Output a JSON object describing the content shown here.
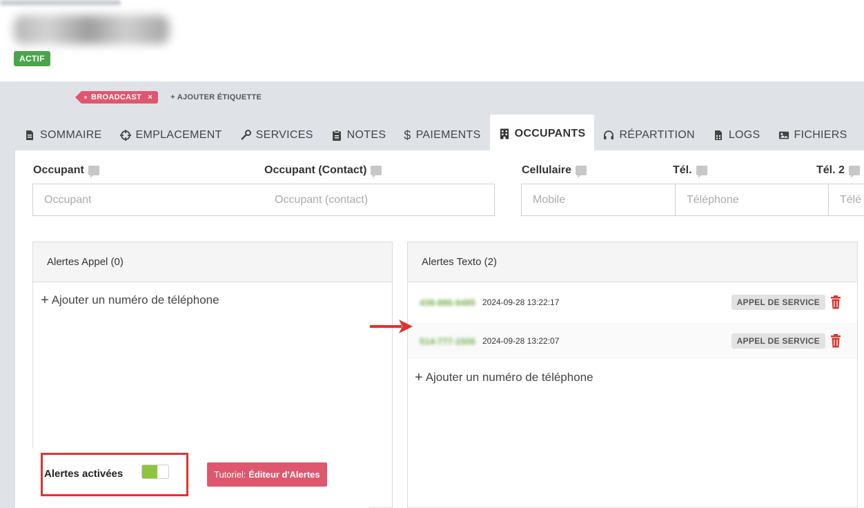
{
  "header": {
    "status": "ACTIF"
  },
  "tags": {
    "items": [
      {
        "label": "BROADCAST",
        "remove": "×"
      }
    ],
    "add_label": "+ AJOUTER ÉTIQUETTE"
  },
  "tabs": [
    {
      "label": "SOMMAIRE",
      "icon": "document-icon"
    },
    {
      "label": "EMPLACEMENT",
      "icon": "crosshair-icon"
    },
    {
      "label": "SERVICES",
      "icon": "wrench-icon"
    },
    {
      "label": "NOTES",
      "icon": "clipboard-icon"
    },
    {
      "label": "PAIEMENTS",
      "icon": "dollar-icon"
    },
    {
      "label": "OCCUPANTS",
      "icon": "building-icon",
      "active": true
    },
    {
      "label": "RÉPARTITION",
      "icon": "headset-icon"
    },
    {
      "label": "LOGS",
      "icon": "calculator-icon"
    },
    {
      "label": "FICHIERS",
      "icon": "image-icon"
    }
  ],
  "fields": [
    {
      "label": "Occupant",
      "placeholder": "Occupant"
    },
    {
      "label": "Occupant (Contact)",
      "placeholder": "Occupant (contact)"
    },
    {
      "label": "Cellulaire",
      "placeholder": "Mobile"
    },
    {
      "label": "Tél.",
      "placeholder": "Téléphone"
    },
    {
      "label": "Tél. 2",
      "placeholder": "Télé"
    }
  ],
  "call_alerts": {
    "title": "Alertes Appel (0)",
    "add_label": "Ajouter un numéro de téléphone"
  },
  "sms_alerts": {
    "title": "Alertes Texto (2)",
    "rows": [
      {
        "phone": "438-886-9485",
        "time": "2024-09-28 13:22:17",
        "badge": "APPEL DE SERVICE"
      },
      {
        "phone": "514-777-1506",
        "time": "2024-09-28 13:22:07",
        "badge": "APPEL DE SERVICE"
      }
    ],
    "add_label": "Ajouter un numéro de téléphone"
  },
  "footer": {
    "toggle_label": "Alertes activées",
    "toggle_on": true,
    "tutorial_prefix": "Tutoriel:",
    "tutorial_name": "Éditeur d'Alertes"
  },
  "colors": {
    "accent_pink": "#e0566e",
    "status_green": "#4aa54a",
    "toggle_green": "#8cc63f",
    "trash_red": "#d9342b",
    "annotation_red": "#e03232"
  }
}
